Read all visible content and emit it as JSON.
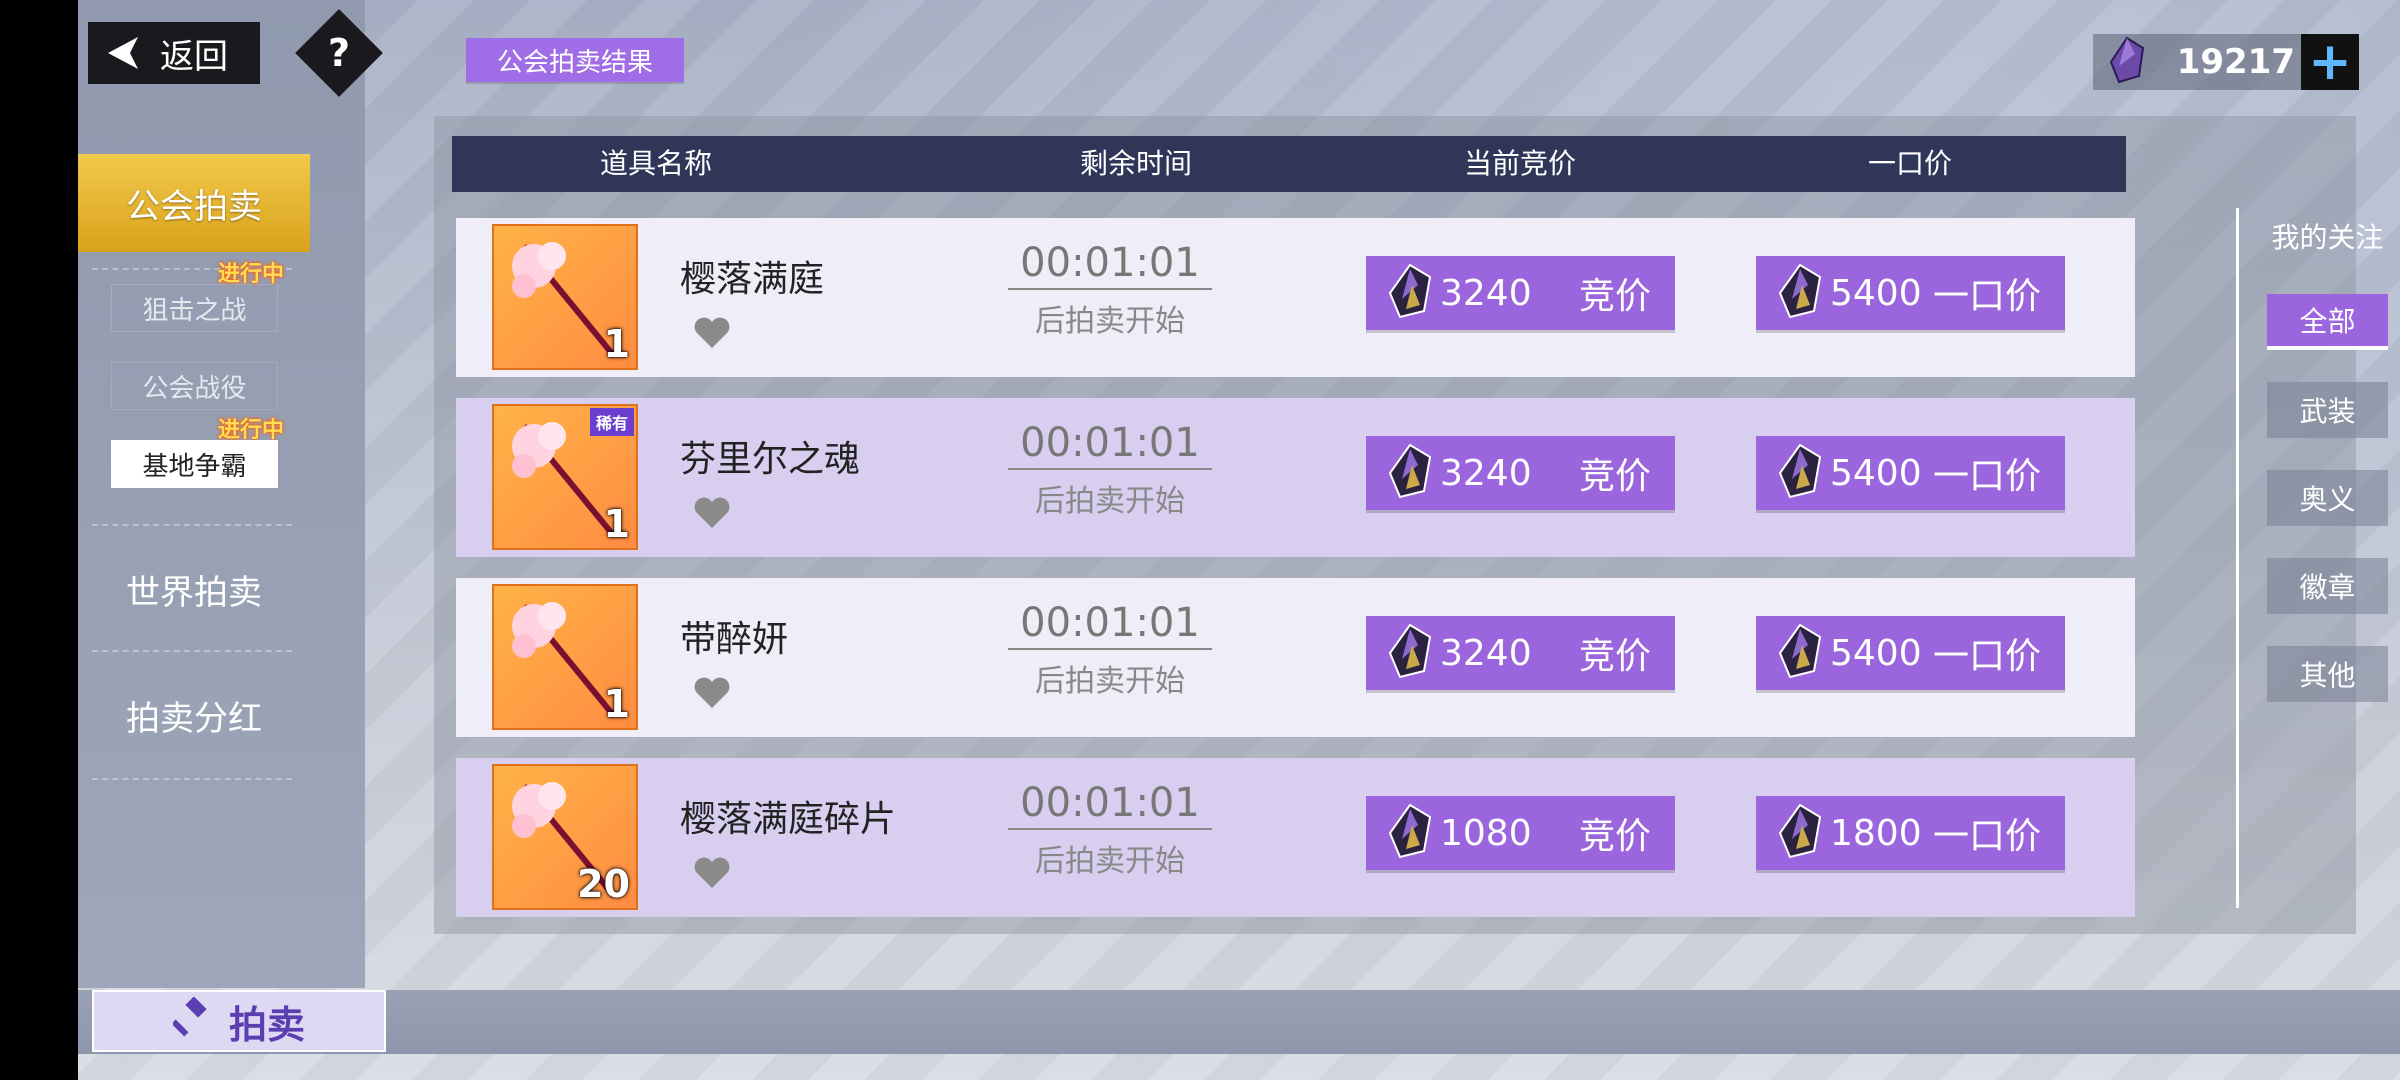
{
  "header_bar": {
    "back_label": "返回",
    "help_label": "?",
    "title": "公会拍卖结果",
    "currency": {
      "icon": "purple-crystal-icon",
      "amount": "19217",
      "add_label": "+"
    }
  },
  "sidebar": {
    "guild_auction": "公会拍卖",
    "sub_items": [
      {
        "label": "狙击之战",
        "badge": "进行中"
      },
      {
        "label": "公会战役",
        "badge": "进行中"
      },
      {
        "label": "基地争霸"
      }
    ],
    "world_auction": "世界拍卖",
    "auction_dividend": "拍卖分红"
  },
  "table": {
    "columns": [
      "道具名称",
      "剩余时间",
      "当前竞价",
      "一口价"
    ],
    "rows": [
      {
        "name": "樱落满庭",
        "qty": "1",
        "rare": "",
        "time": "00:01:01",
        "time_note": "后拍卖开始",
        "bid": "3240",
        "bid_label": "竞价",
        "buyout": "5400",
        "buyout_label": "一口价"
      },
      {
        "name": "芬里尔之魂",
        "qty": "1",
        "rare": "稀有",
        "time": "00:01:01",
        "time_note": "后拍卖开始",
        "bid": "3240",
        "bid_label": "竞价",
        "buyout": "5400",
        "buyout_label": "一口价"
      },
      {
        "name": "带醉妍",
        "qty": "1",
        "rare": "",
        "time": "00:01:01",
        "time_note": "后拍卖开始",
        "bid": "3240",
        "bid_label": "竞价",
        "buyout": "5400",
        "buyout_label": "一口价"
      },
      {
        "name": "樱落满庭碎片",
        "qty": "20",
        "rare": "",
        "time": "00:01:01",
        "time_note": "后拍卖开始",
        "bid": "1080",
        "bid_label": "竞价",
        "buyout": "1800",
        "buyout_label": "一口价"
      }
    ]
  },
  "filters": {
    "my_watch": "我的关注",
    "items": [
      "全部",
      "武装",
      "奥义",
      "徽章",
      "其他"
    ],
    "active": "全部"
  },
  "bottom": {
    "auction_tab": "拍卖"
  },
  "colors": {
    "accent": "#9b66dd",
    "header": "#2f3658",
    "gold": "#f2c94c"
  }
}
